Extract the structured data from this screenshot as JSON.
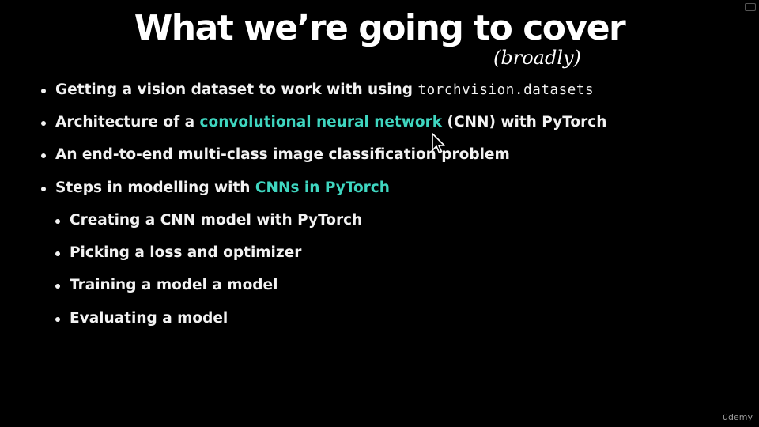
{
  "slide": {
    "title": "What we’re going to cover",
    "subtitle": "(broadly)",
    "bullets": [
      {
        "parts": [
          "Getting a vision dataset to work with using ",
          "torchvision.datasets"
        ]
      },
      {
        "parts": [
          "Architecture of a ",
          "convolutional neural network",
          " (CNN) with PyTorch"
        ]
      },
      {
        "parts": [
          "An end-to-end multi-class image classification problem"
        ]
      },
      {
        "parts": [
          "Steps in modelling with ",
          "CNNs in PyTorch"
        ]
      }
    ],
    "sub_bullets": [
      "Creating a CNN model with PyTorch",
      "Picking a loss and optimizer",
      "Training a model a model",
      "Evaluating a model"
    ]
  },
  "watermark": "üdemy",
  "colors": {
    "background": "#000000",
    "text": "#f2f2f2",
    "accent": "#3fd6c0"
  },
  "icons": {
    "cursor": "mouse-pointer-icon"
  }
}
